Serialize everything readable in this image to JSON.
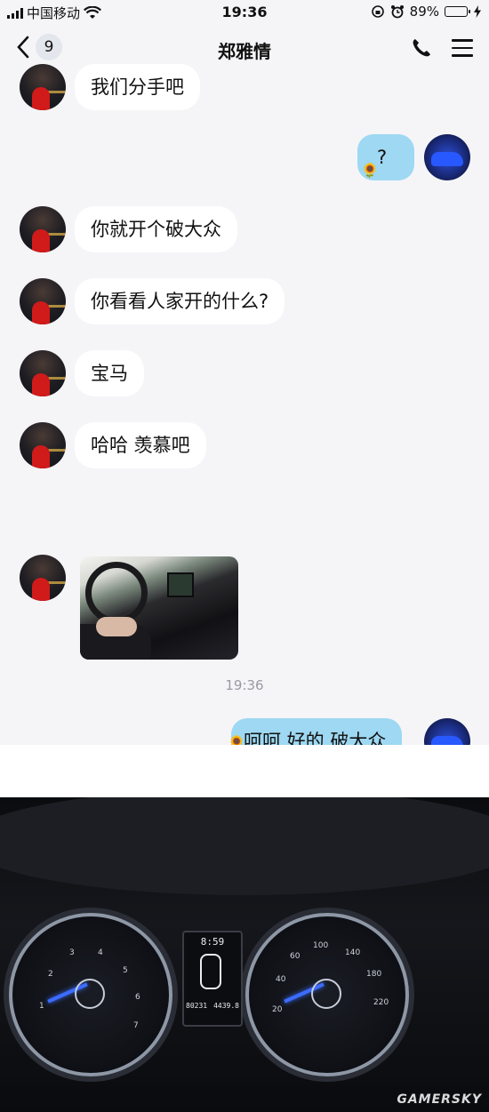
{
  "status_bar": {
    "carrier": "中国移动",
    "time": "19:36",
    "battery": "89%"
  },
  "nav": {
    "unread_count": "9",
    "title": "郑雅情"
  },
  "messages": [
    {
      "from": "her",
      "text": "我们分手吧"
    },
    {
      "from": "me",
      "text": "?"
    },
    {
      "from": "her",
      "text": "你就开个破大众"
    },
    {
      "from": "her",
      "text": "你看看人家开的什么?"
    },
    {
      "from": "her",
      "text": "宝马"
    },
    {
      "from": "her",
      "text": "哈哈 羡慕吧"
    },
    {
      "from": "her",
      "type": "photo"
    },
    {
      "from": "me",
      "text": "呵呵 好的 破大众"
    }
  ],
  "timestamp": "19:36",
  "dashboard_photo": {
    "clock": "8:59",
    "odometer": "80231",
    "trip": "4439.8",
    "watermark": "GAMERSKY"
  },
  "colors": {
    "my_bubble": "#9ed8f2",
    "her_bubble": "#ffffff",
    "background": "#f5f5f8",
    "battery": "#2ecc40"
  },
  "icons": [
    "back-chevron-icon",
    "wifi-icon",
    "alarm-icon",
    "phone-icon",
    "menu-icon",
    "sunflower-icon"
  ]
}
